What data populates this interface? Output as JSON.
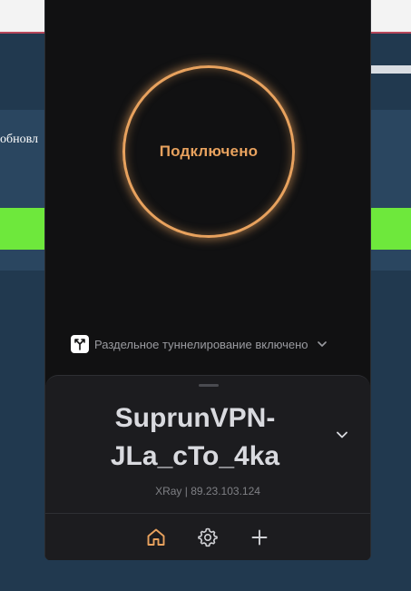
{
  "background_page": {
    "text_fragment": "обновл"
  },
  "vpn": {
    "status_label": "Подключено",
    "split_tunnel": {
      "label": "Раздельное туннелирование включено",
      "icon": "split-arrows-icon"
    },
    "server": {
      "name": "SuprunVPN-JLa_cTo_4ka",
      "info": "XRay | 89.23.103.124"
    },
    "nav": {
      "items": [
        {
          "icon": "home-icon",
          "active": true
        },
        {
          "icon": "gear-icon",
          "active": false
        },
        {
          "icon": "plus-icon",
          "active": false
        }
      ]
    }
  },
  "colors": {
    "accent": "#e8a25e",
    "popup_bg": "#111112",
    "sheet_bg": "#1c1c1f",
    "page_bg": "#21394f",
    "green": "#6ee83c"
  }
}
